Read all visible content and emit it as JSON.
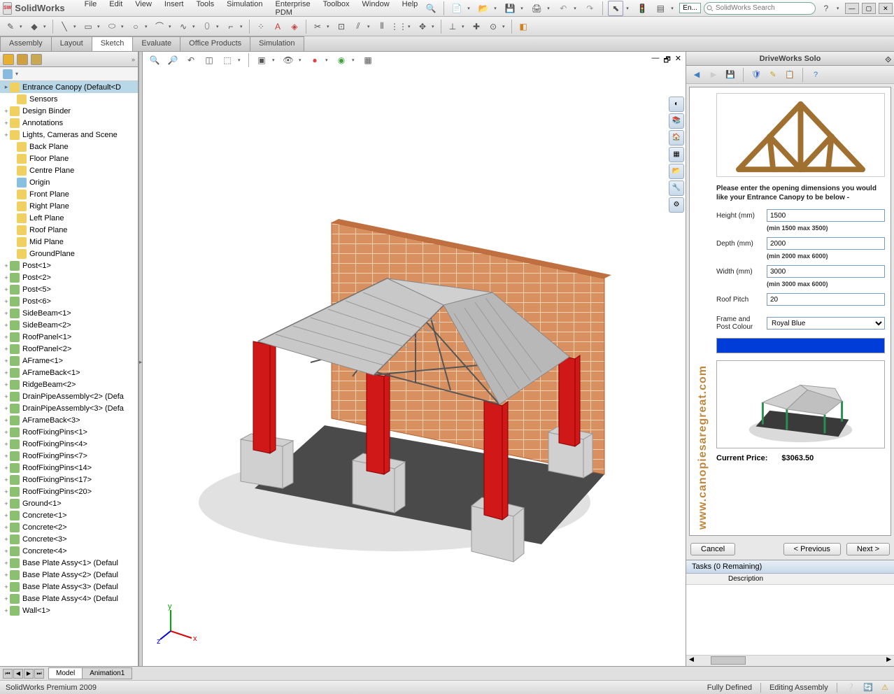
{
  "app": {
    "name": "SolidWorks"
  },
  "menu": [
    "File",
    "Edit",
    "View",
    "Insert",
    "Tools",
    "Simulation",
    "Enterprise PDM",
    "Toolbox",
    "Window",
    "Help"
  ],
  "search": {
    "placeholder": "SolidWorks Search"
  },
  "topToolbar": {
    "dropdownText": "En..."
  },
  "ribbonTabs": [
    "Assembly",
    "Layout",
    "Sketch",
    "Evaluate",
    "Office Products",
    "Simulation"
  ],
  "activeRibbonTab": "Sketch",
  "tree": {
    "root": "Entrance Canopy  (Default<D",
    "items": [
      {
        "exp": "",
        "ico": "y",
        "label": "Sensors"
      },
      {
        "exp": "+",
        "ico": "y",
        "label": "Design Binder"
      },
      {
        "exp": "+",
        "ico": "y",
        "label": "Annotations"
      },
      {
        "exp": "+",
        "ico": "y",
        "label": "Lights, Cameras and Scene"
      },
      {
        "exp": "",
        "ico": "y",
        "label": "Back Plane"
      },
      {
        "exp": "",
        "ico": "y",
        "label": "Floor Plane"
      },
      {
        "exp": "",
        "ico": "y",
        "label": "Centre Plane"
      },
      {
        "exp": "",
        "ico": "b",
        "label": "Origin"
      },
      {
        "exp": "",
        "ico": "y",
        "label": "Front Plane"
      },
      {
        "exp": "",
        "ico": "y",
        "label": "Right Plane"
      },
      {
        "exp": "",
        "ico": "y",
        "label": "Left Plane"
      },
      {
        "exp": "",
        "ico": "y",
        "label": "Roof Plane"
      },
      {
        "exp": "",
        "ico": "y",
        "label": "Mid Plane"
      },
      {
        "exp": "",
        "ico": "y",
        "label": "GroundPlane"
      },
      {
        "exp": "+",
        "ico": "g",
        "label": "Post<1>"
      },
      {
        "exp": "+",
        "ico": "g",
        "label": "Post<2>"
      },
      {
        "exp": "+",
        "ico": "g",
        "label": "Post<5>"
      },
      {
        "exp": "+",
        "ico": "g",
        "label": "Post<6>"
      },
      {
        "exp": "+",
        "ico": "g",
        "label": "SideBeam<1>"
      },
      {
        "exp": "+",
        "ico": "g",
        "label": "SideBeam<2>"
      },
      {
        "exp": "+",
        "ico": "g",
        "label": "RoofPanel<1>"
      },
      {
        "exp": "+",
        "ico": "g",
        "label": "RoofPanel<2>"
      },
      {
        "exp": "+",
        "ico": "g",
        "label": "AFrame<1>"
      },
      {
        "exp": "+",
        "ico": "g",
        "label": "AFrameBack<1>"
      },
      {
        "exp": "+",
        "ico": "g",
        "label": "RidgeBeam<2>"
      },
      {
        "exp": "+",
        "ico": "g",
        "label": "DrainPipeAssembly<2> (Defa"
      },
      {
        "exp": "+",
        "ico": "g",
        "label": "DrainPipeAssembly<3> (Defa"
      },
      {
        "exp": "+",
        "ico": "g",
        "label": "AFrameBack<3>"
      },
      {
        "exp": "+",
        "ico": "g",
        "label": "RoofFixingPins<1>"
      },
      {
        "exp": "+",
        "ico": "g",
        "label": "RoofFixingPins<4>"
      },
      {
        "exp": "+",
        "ico": "g",
        "label": "RoofFixingPins<7>"
      },
      {
        "exp": "+",
        "ico": "g",
        "label": "RoofFixingPins<14>"
      },
      {
        "exp": "+",
        "ico": "g",
        "label": "RoofFixingPins<17>"
      },
      {
        "exp": "+",
        "ico": "g",
        "label": "RoofFixingPins<20>"
      },
      {
        "exp": "+",
        "ico": "g",
        "label": "Ground<1>"
      },
      {
        "exp": "+",
        "ico": "g",
        "label": "Concrete<1>"
      },
      {
        "exp": "+",
        "ico": "g",
        "label": "Concrete<2>"
      },
      {
        "exp": "+",
        "ico": "g",
        "label": "Concrete<3>"
      },
      {
        "exp": "+",
        "ico": "g",
        "label": "Concrete<4>"
      },
      {
        "exp": "+",
        "ico": "g",
        "label": "Base Plate Assy<1> (Defaul"
      },
      {
        "exp": "+",
        "ico": "g",
        "label": "Base Plate Assy<2> (Defaul"
      },
      {
        "exp": "+",
        "ico": "g",
        "label": "Base Plate Assy<3> (Defaul"
      },
      {
        "exp": "+",
        "ico": "g",
        "label": "Base Plate Assy<4> (Defaul"
      },
      {
        "exp": "+",
        "ico": "g",
        "label": "Wall<1>"
      }
    ]
  },
  "bottomTabs": [
    "Model",
    "Animation1"
  ],
  "status": {
    "left": "SolidWorks Premium 2009",
    "state": "Fully Defined",
    "mode": "Editing Assembly"
  },
  "driveworks": {
    "title": "DriveWorks Solo",
    "url": "www.canopiesaregreat.com",
    "instructions": "Please enter the opening dimensions you would like your Entrance Canopy to be below -",
    "fields": {
      "height": {
        "label": "Height (mm)",
        "value": "1500",
        "hint": "(min 1500 max 3500)"
      },
      "depth": {
        "label": "Depth (mm)",
        "value": "2000",
        "hint": "(min 2000 max 6000)"
      },
      "width": {
        "label": "Width (mm)",
        "value": "3000",
        "hint": "(min 3000 max 6000)"
      },
      "pitch": {
        "label": "Roof Pitch",
        "value": "20"
      },
      "colour": {
        "label": "Frame and Post Colour",
        "value": "Royal Blue"
      }
    },
    "swatchColor": "#0033d0",
    "priceLabel": "Current Price:",
    "priceValue": "$3063.50",
    "buttons": {
      "cancel": "Cancel",
      "prev": "< Previous",
      "next": "Next >"
    },
    "tasks": {
      "header": "Tasks (0 Remaining)",
      "col": "Description"
    }
  },
  "coord": {
    "x": "x",
    "y": "y",
    "z": "z"
  }
}
